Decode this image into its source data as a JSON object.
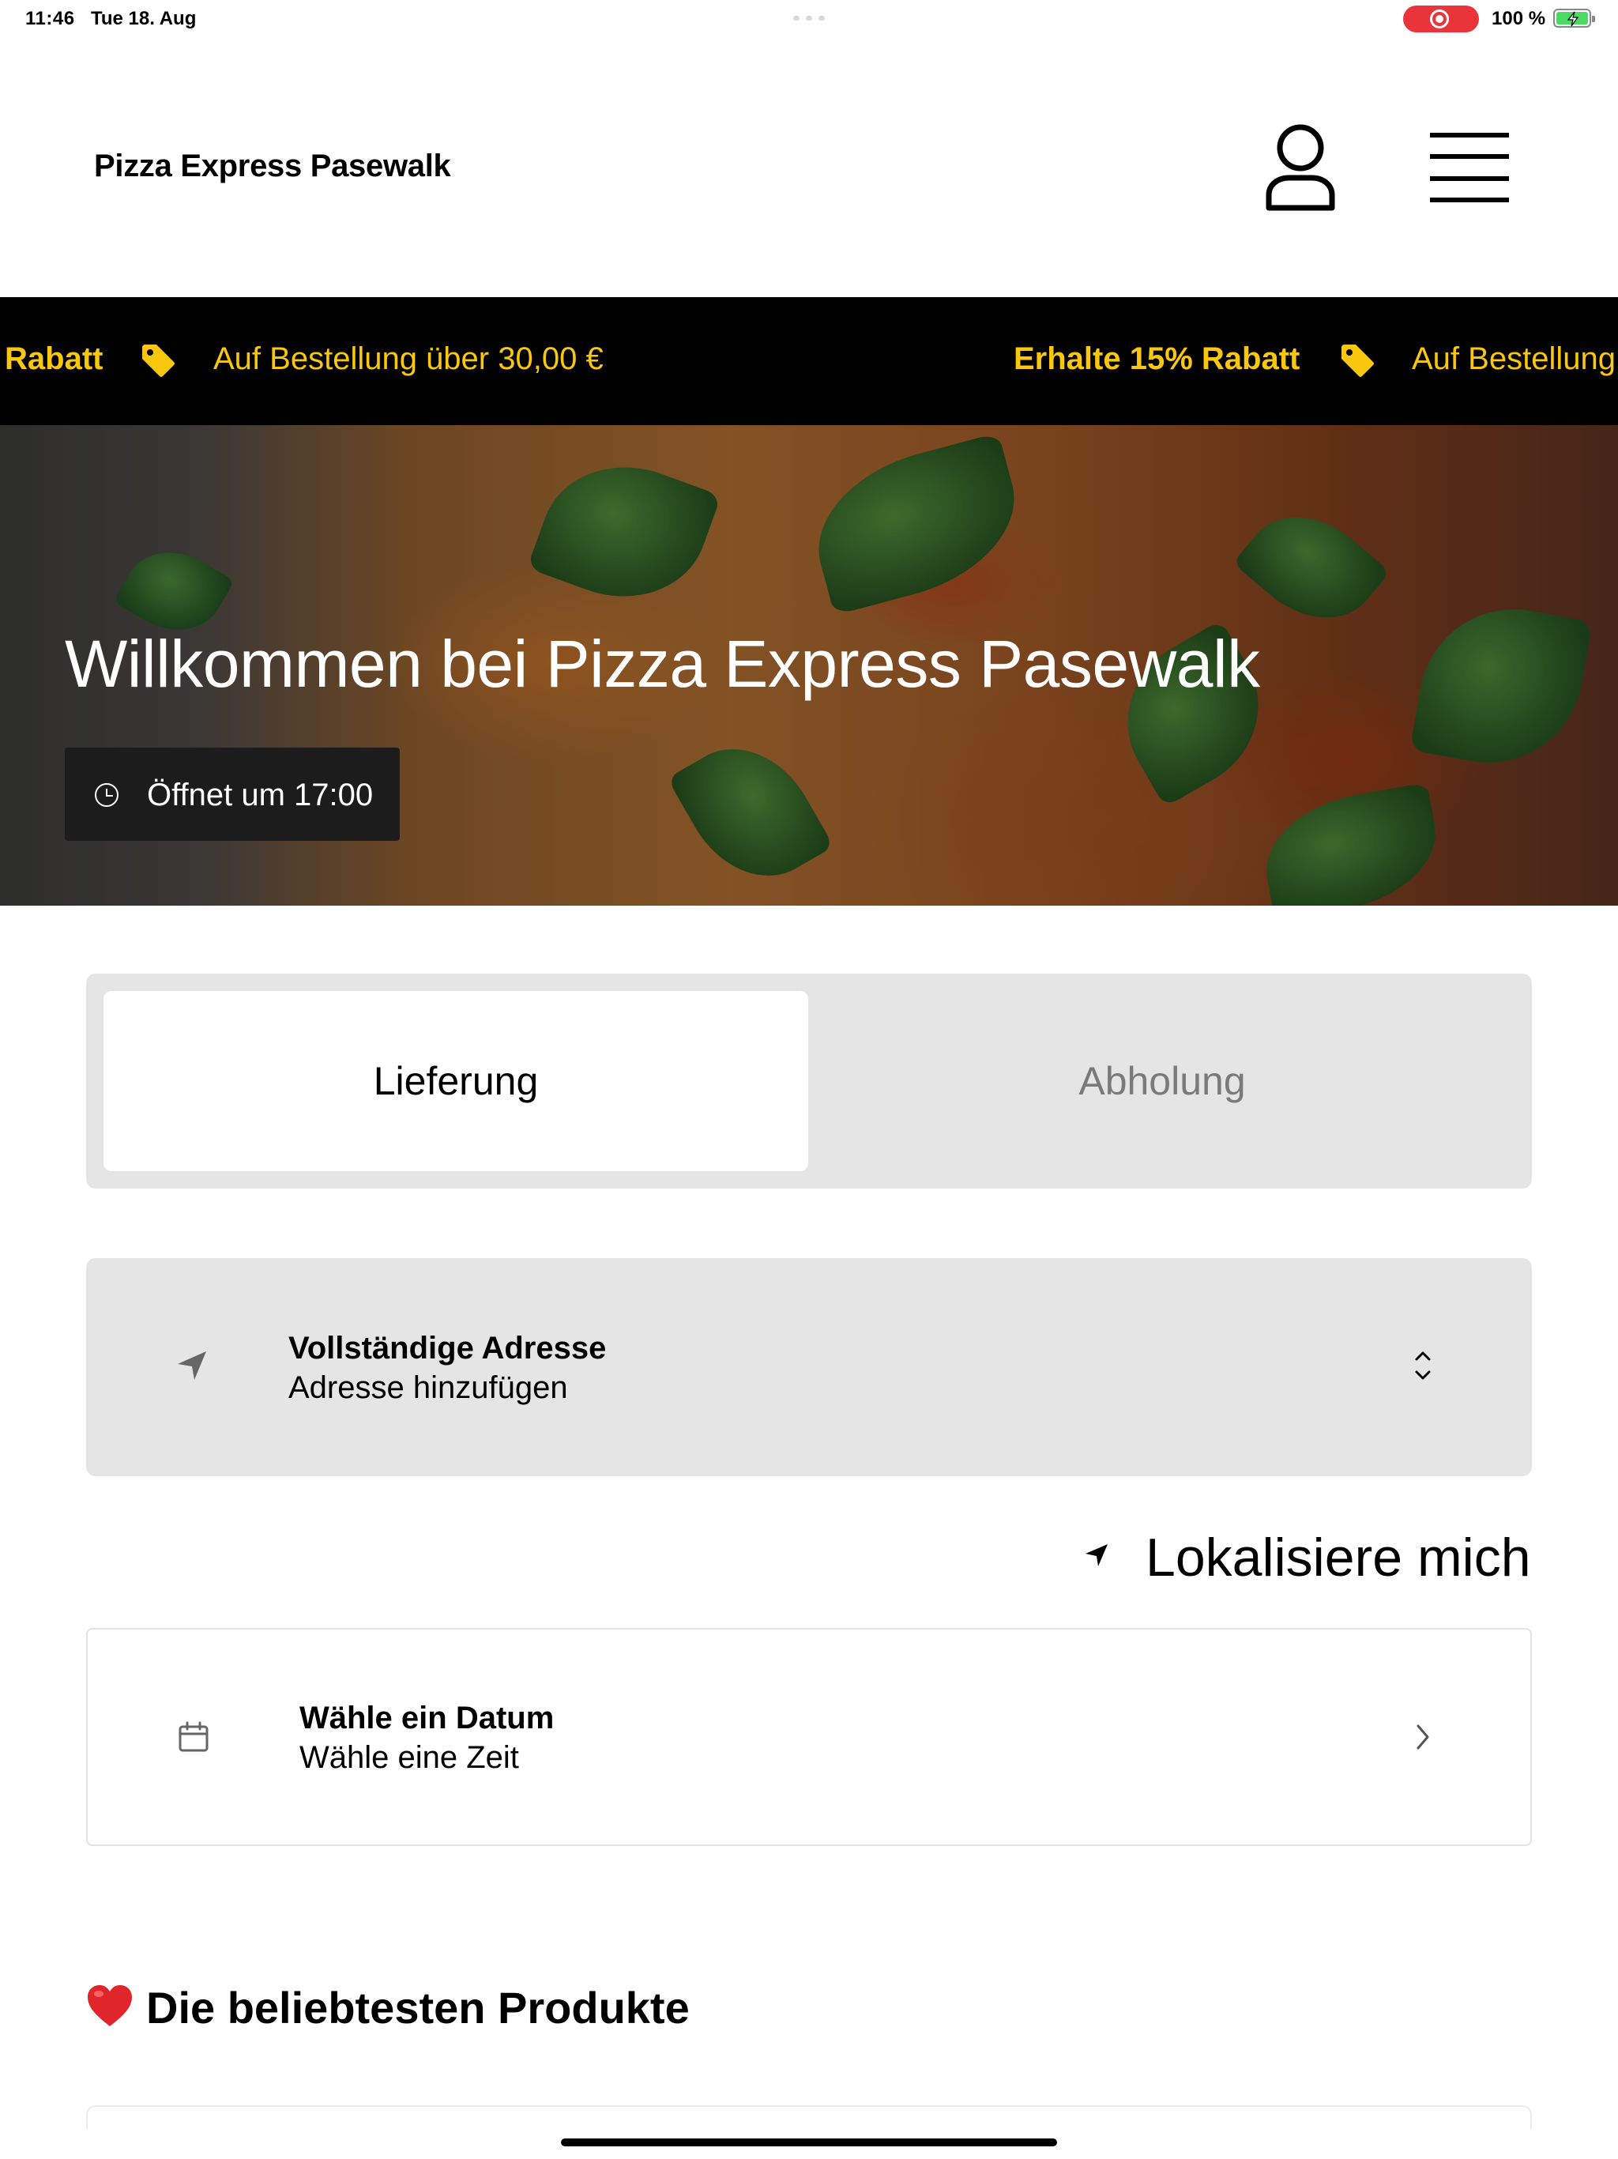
{
  "status_bar": {
    "time": "11:46",
    "date": "Tue 18. Aug",
    "battery": "100 %"
  },
  "header": {
    "brand": "Pizza Express Pasewalk",
    "account_icon": "user-icon",
    "menu_icon": "hamburger-icon"
  },
  "promo": {
    "items": [
      {
        "bold": "Rabatt",
        "text": "Auf Bestellung über 30,00 €"
      },
      {
        "bold": "Erhalte 15% Rabatt",
        "text": "Auf Bestellung"
      }
    ],
    "color": "#f9c80e",
    "icon": "tag-icon"
  },
  "hero": {
    "title": "Willkommen bei Pizza Express Pasewalk",
    "open_status": "Öffnet um 17:00",
    "clock_icon": "clock-icon"
  },
  "mode_toggle": {
    "options": [
      "Lieferung",
      "Abholung"
    ],
    "selected": "Lieferung"
  },
  "address": {
    "label": "Vollständige Adresse",
    "placeholder": "Adresse hinzufügen",
    "icon": "location-arrow-icon"
  },
  "locate": {
    "label": "Lokalisiere mich"
  },
  "schedule": {
    "label": "Wähle ein Datum",
    "sublabel": "Wähle eine Zeit",
    "icon": "calendar-icon"
  },
  "popular": {
    "title": "Die beliebtesten Produkte"
  }
}
